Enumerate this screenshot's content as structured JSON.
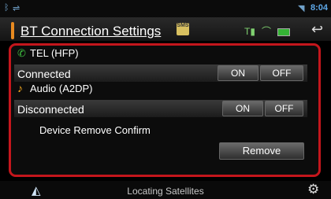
{
  "statusbar": {
    "bt_icon": "bluetooth-icon",
    "sync_icon": "usb-icon",
    "wifi_icon": "wifi-icon",
    "time": "8:04"
  },
  "header": {
    "title": "BT Connection Settings",
    "sms_badge": "SMS",
    "icons": [
      "signal-icon",
      "phone-hook-icon",
      "battery-icon",
      "back-icon"
    ]
  },
  "tel": {
    "label": "TEL (HFP)",
    "status": "Connected",
    "on_label": "ON",
    "off_label": "OFF"
  },
  "audio": {
    "label": "Audio (A2DP)",
    "status": "Disconnected",
    "on_label": "ON",
    "off_label": "OFF"
  },
  "device_remove": {
    "label": "Device Remove Confirm",
    "button_label": "Remove"
  },
  "bottombar": {
    "status": "Locating Satellites",
    "icons": [
      "navigation-icon",
      "settings-gear-icon"
    ]
  },
  "colors": {
    "highlight_border": "#c4161c",
    "title_accent": "#e88a20",
    "tel_icon": "#3ec040",
    "audio_icon": "#ffb020",
    "time_color": "#5ea8e8"
  }
}
